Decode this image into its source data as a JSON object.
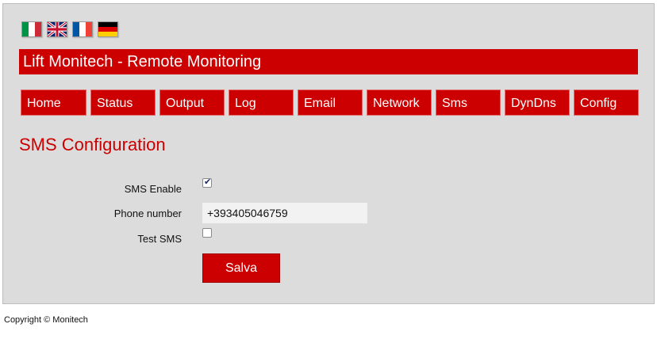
{
  "flags": [
    {
      "name": "italian-flag-icon",
      "lang": "Italiano"
    },
    {
      "name": "uk-flag-icon",
      "lang": "English"
    },
    {
      "name": "french-flag-icon",
      "lang": "Français"
    },
    {
      "name": "german-flag-icon",
      "lang": "Deutsch"
    }
  ],
  "header": {
    "title": "Lift Monitech - Remote Monitoring"
  },
  "nav": {
    "items": [
      "Home",
      "Status",
      "Output",
      "Log",
      "Email",
      "Network",
      "Sms",
      "DynDns",
      "Config"
    ]
  },
  "section": {
    "title": "SMS Configuration"
  },
  "form": {
    "sms_enable_label": "SMS Enable",
    "sms_enable_checked": true,
    "phone_label": "Phone number",
    "phone_value": "+393405046759",
    "test_sms_label": "Test SMS",
    "test_sms_checked": false,
    "save_label": "Salva"
  },
  "footer": {
    "copyright": "Copyright © Monitech"
  },
  "colors": {
    "accent": "#cc0000",
    "panel": "#dcdcdd"
  }
}
